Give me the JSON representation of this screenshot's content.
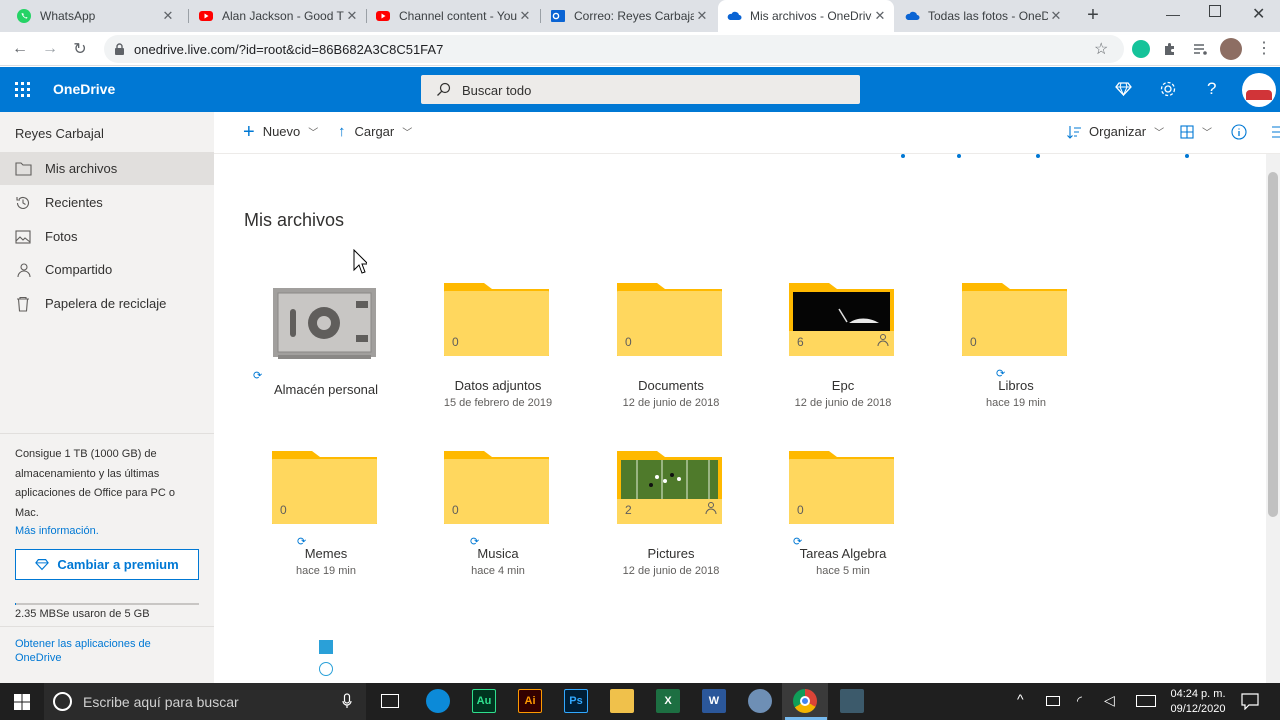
{
  "browser": {
    "tabs": [
      {
        "title": "WhatsApp",
        "favicon": "whatsapp-icon",
        "active": false
      },
      {
        "title": "Alan Jackson - Good Time",
        "favicon": "youtube-icon",
        "active": false
      },
      {
        "title": "Channel content - YouTube",
        "favicon": "youtube-icon",
        "active": false
      },
      {
        "title": "Correo: Reyes Carbajal",
        "favicon": "outlook-icon",
        "active": false
      },
      {
        "title": "Mis archivos - OneDrive",
        "favicon": "onedrive-icon",
        "active": true
      },
      {
        "title": "Todas las fotos - OneDrive",
        "favicon": "onedrive-icon",
        "active": false
      }
    ],
    "new_tab": "+",
    "url": "onedrive.live.com/?id=root&cid=86B682A3C8C51FA7"
  },
  "header": {
    "app_name": "OneDrive",
    "search_placeholder": "Buscar todo"
  },
  "sidebar": {
    "user_name": "Reyes Carbajal",
    "items": [
      {
        "label": "Mis archivos",
        "icon": "folder-icon",
        "selected": true
      },
      {
        "label": "Recientes",
        "icon": "history-icon",
        "selected": false
      },
      {
        "label": "Fotos",
        "icon": "photo-icon",
        "selected": false
      },
      {
        "label": "Compartido",
        "icon": "shared-people-icon",
        "selected": false
      },
      {
        "label": "Papelera de reciclaje",
        "icon": "recycle-bin-icon",
        "selected": false
      }
    ],
    "promo_text": "Consigue 1 TB (1000 GB) de almacenamiento y las últimas aplicaciones de Office para PC o Mac.",
    "more_info": "Más información.",
    "premium_button": "Cambiar a premium",
    "storage_text": "2.35 MBSe usaron de 5 GB",
    "storage_used_fraction": 0.0005,
    "get_apps": "Obtener las aplicaciones de OneDrive"
  },
  "commandbar": {
    "new_label": "Nuevo",
    "upload_label": "Cargar",
    "sort_label": "Organizar"
  },
  "main": {
    "title": "Mis archivos",
    "items": [
      {
        "name": "Almacén personal",
        "date": "",
        "count": "",
        "type": "vault"
      },
      {
        "name": "Datos adjuntos",
        "date": "15 de febrero de 2019",
        "count": "0",
        "type": "folder"
      },
      {
        "name": "Documents",
        "date": "12 de junio de 2018",
        "count": "0",
        "type": "folder"
      },
      {
        "name": "Epc",
        "date": "12 de junio de 2018",
        "count": "6",
        "type": "folder-shared-dark"
      },
      {
        "name": "Libros",
        "date": "hace 19 min",
        "count": "0",
        "type": "folder"
      },
      {
        "name": "Memes",
        "date": "hace 19 min",
        "count": "0",
        "type": "folder"
      },
      {
        "name": "Musica",
        "date": "hace 4 min",
        "count": "0",
        "type": "folder"
      },
      {
        "name": "Pictures",
        "date": "12 de junio de 2018",
        "count": "2",
        "type": "folder-shared-field"
      },
      {
        "name": "Tareas Algebra",
        "date": "hace 5 min",
        "count": "0",
        "type": "folder"
      }
    ]
  },
  "taskbar": {
    "search_placeholder": "Escribe aquí para buscar",
    "apps": [
      {
        "label": "",
        "icon": "edge-icon"
      },
      {
        "label": "Au",
        "icon": "audition-icon"
      },
      {
        "label": "Ai",
        "icon": "illustrator-icon"
      },
      {
        "label": "Ps",
        "icon": "photoshop-icon"
      },
      {
        "label": "",
        "icon": "file-explorer-icon"
      },
      {
        "label": "",
        "icon": "excel-icon"
      },
      {
        "label": "",
        "icon": "word-icon"
      },
      {
        "label": "",
        "icon": "app-icon"
      },
      {
        "label": "",
        "icon": "chrome-icon"
      },
      {
        "label": "",
        "icon": "app-icon"
      }
    ],
    "time": "04:24 p. m.",
    "date": "09/12/2020"
  },
  "colors": {
    "brand": "#0078d4",
    "folder": "#ffd75e",
    "folder_tab": "#ffb900"
  }
}
